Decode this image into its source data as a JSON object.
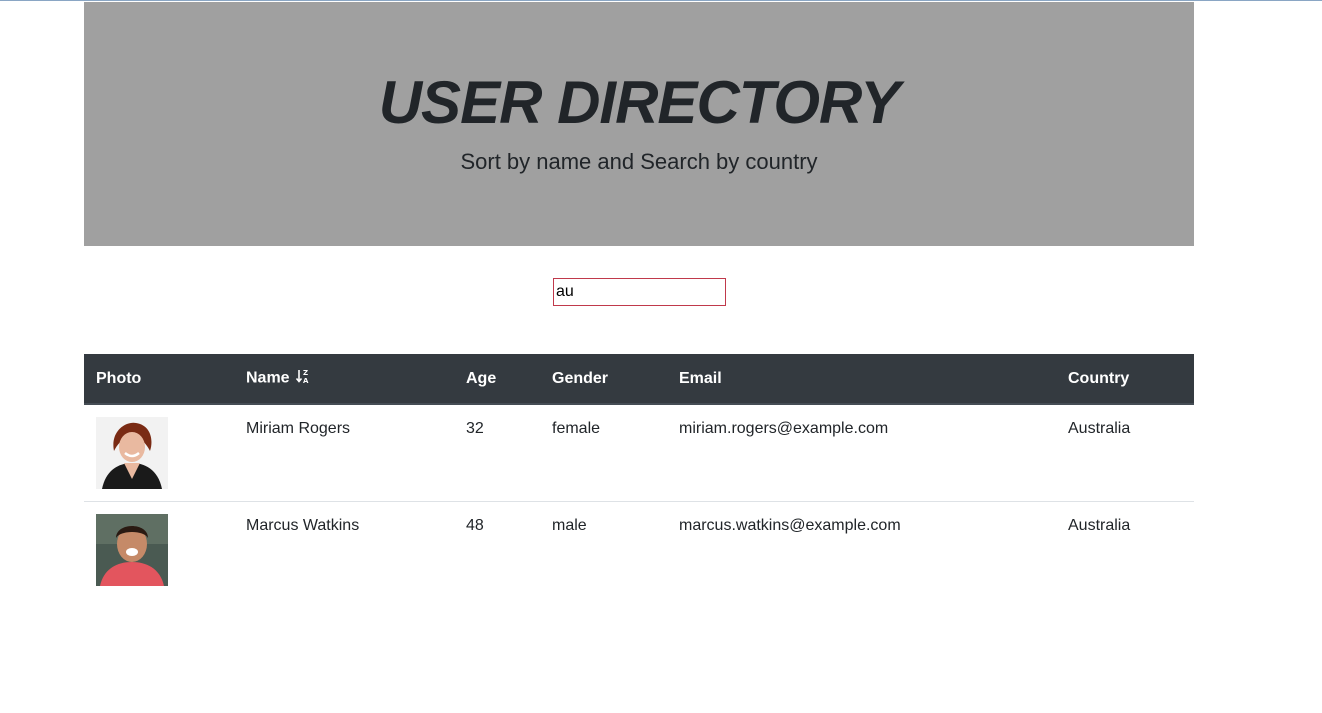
{
  "header": {
    "title": "USER DIRECTORY",
    "subtitle": "Sort by name and Search by country"
  },
  "search": {
    "value": "au"
  },
  "table": {
    "columns": {
      "photo": "Photo",
      "name": "Name",
      "age": "Age",
      "gender": "Gender",
      "email": "Email",
      "country": "Country"
    },
    "sort_icon": "sort-alpha-down-icon",
    "rows": [
      {
        "name": "Miriam Rogers",
        "age": "32",
        "gender": "female",
        "email": "miriam.rogers@example.com",
        "country": "Australia"
      },
      {
        "name": "Marcus Watkins",
        "age": "48",
        "gender": "male",
        "email": "marcus.watkins@example.com",
        "country": "Australia"
      }
    ]
  },
  "colors": {
    "hero_bg": "#a0a0a0",
    "table_header_bg": "#343a40",
    "input_border": "#c0394b"
  }
}
